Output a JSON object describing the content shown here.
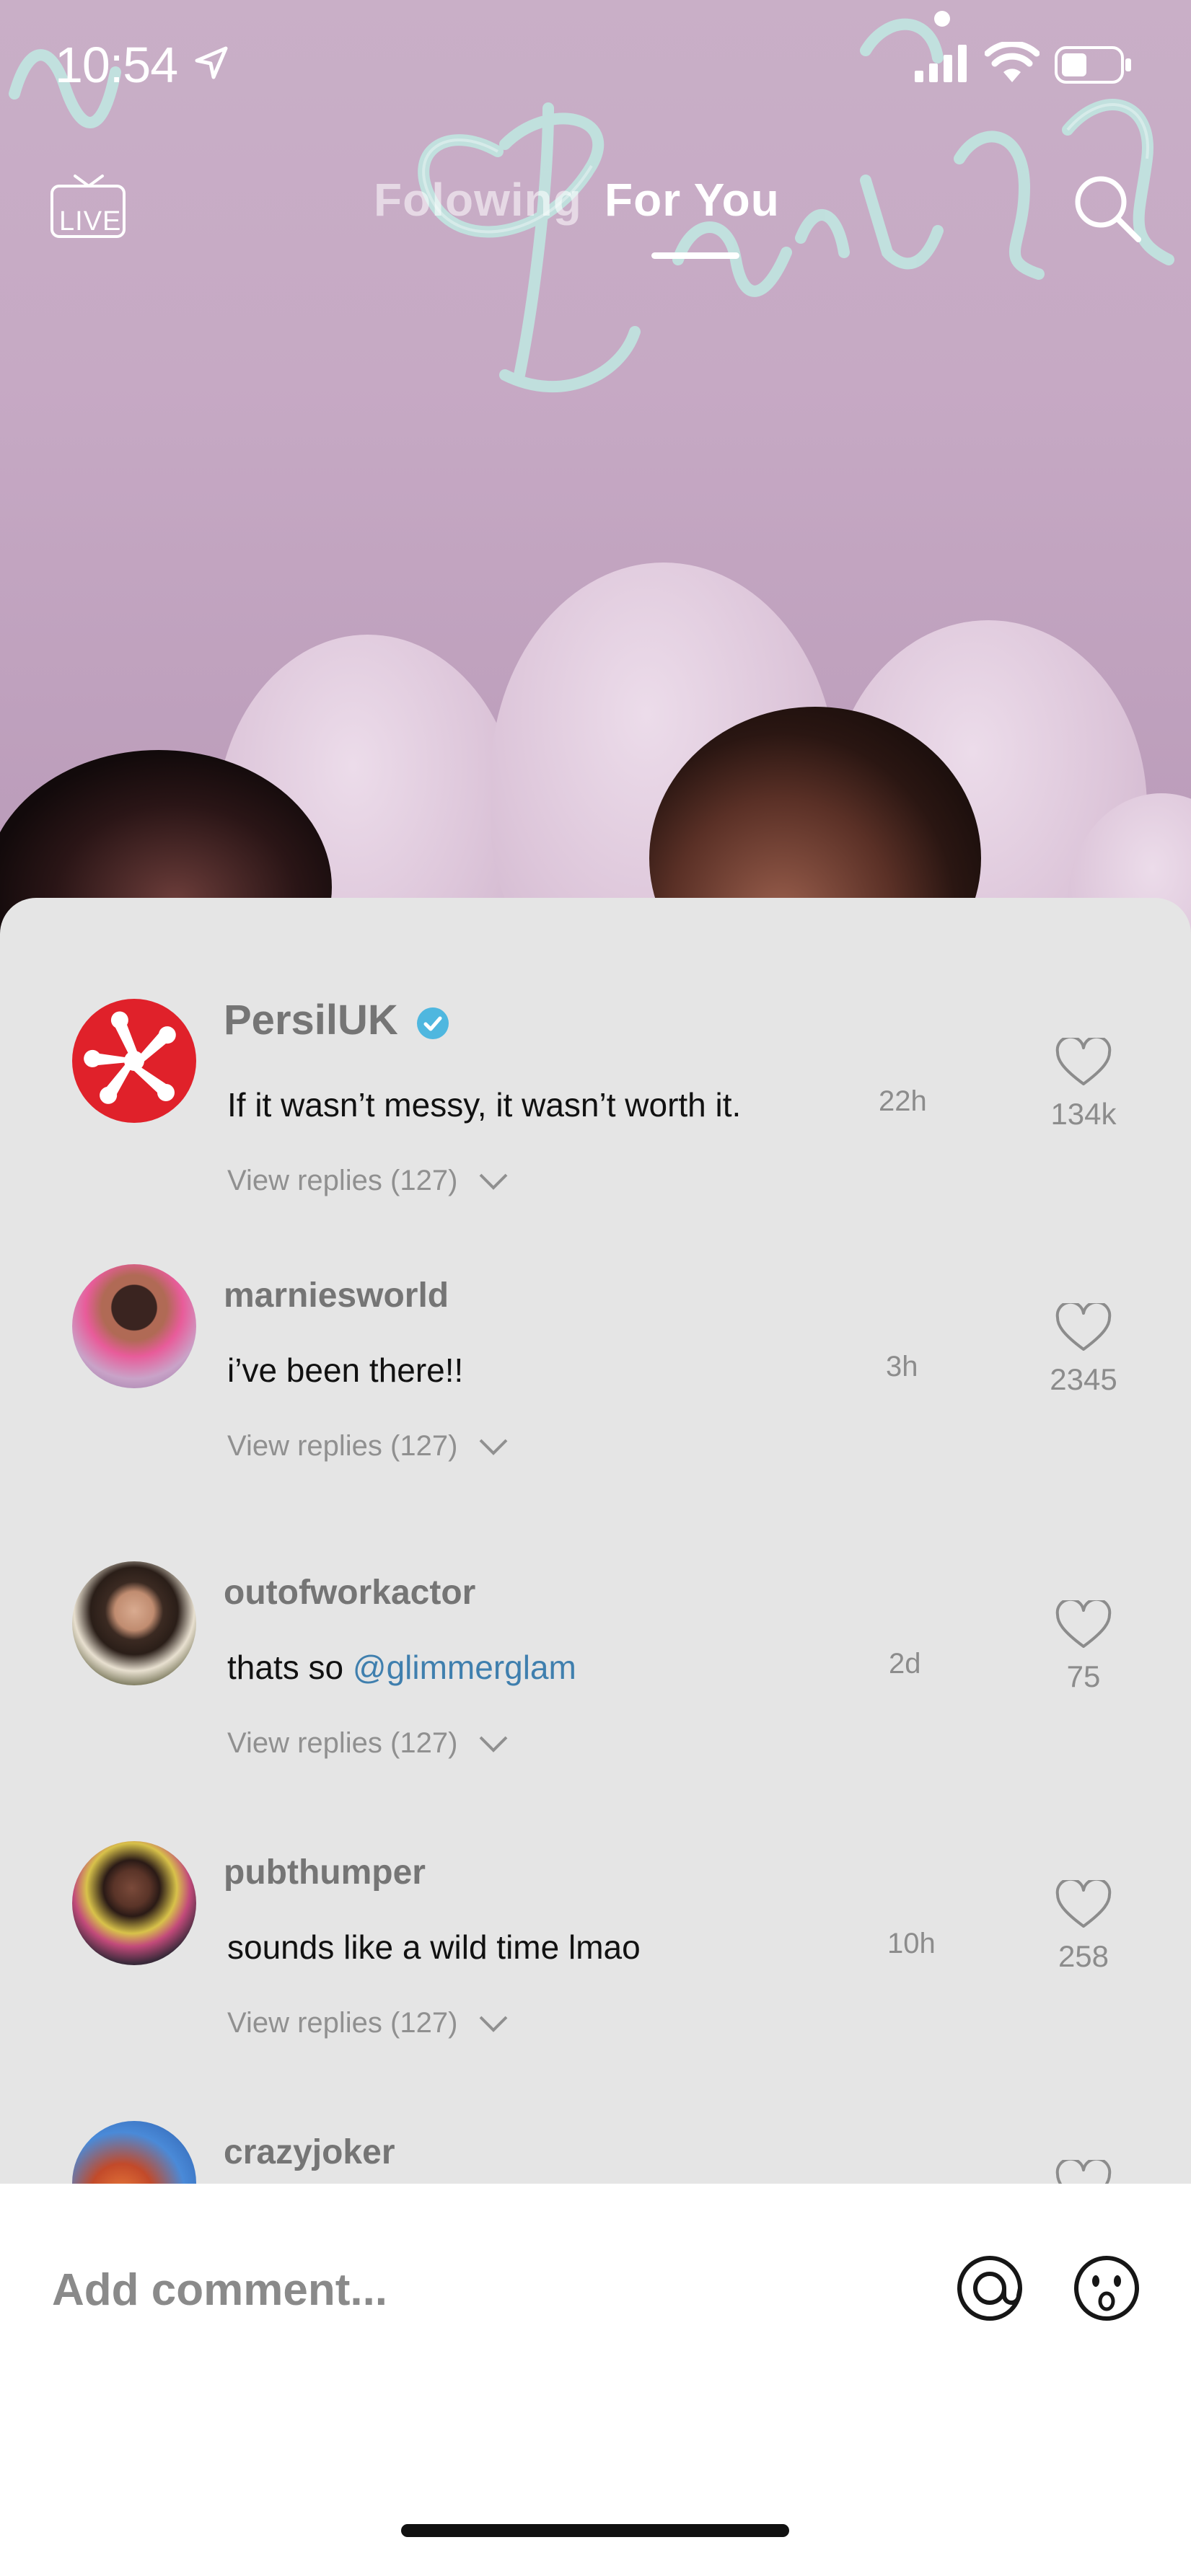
{
  "status_bar": {
    "time": "10:54"
  },
  "nav": {
    "live_label": "LIVE",
    "tabs": [
      {
        "label": "Folowing",
        "active": false
      },
      {
        "label": "For You",
        "active": true
      }
    ]
  },
  "comments": [
    {
      "username": "PersilUK",
      "verified": true,
      "text": "If it wasn’t messy, it wasn’t worth it.",
      "time": "22h",
      "replies": "View replies (127)",
      "likes": "134k"
    },
    {
      "username": "marniesworld",
      "verified": false,
      "text": "i’ve been there!!",
      "time": "3h",
      "replies": "View replies (127)",
      "likes": "2345"
    },
    {
      "username": "outofworkactor",
      "verified": false,
      "text_prefix": "thats so ",
      "mention": "@glimmerglam",
      "time": "2d",
      "replies": "View replies (127)",
      "likes": "75"
    },
    {
      "username": "pubthumper",
      "verified": false,
      "text": "sounds like a wild time lmao",
      "time": "10h",
      "replies": "View replies (127)",
      "likes": "258"
    },
    {
      "username": "crazyjoker",
      "verified": false
    }
  ],
  "composer": {
    "placeholder": "Add comment..."
  },
  "colors": {
    "sheet": "#e5e5e5",
    "mention": "#3f7fae",
    "persil_red": "#e0212a",
    "verified": "#4fb7df"
  }
}
